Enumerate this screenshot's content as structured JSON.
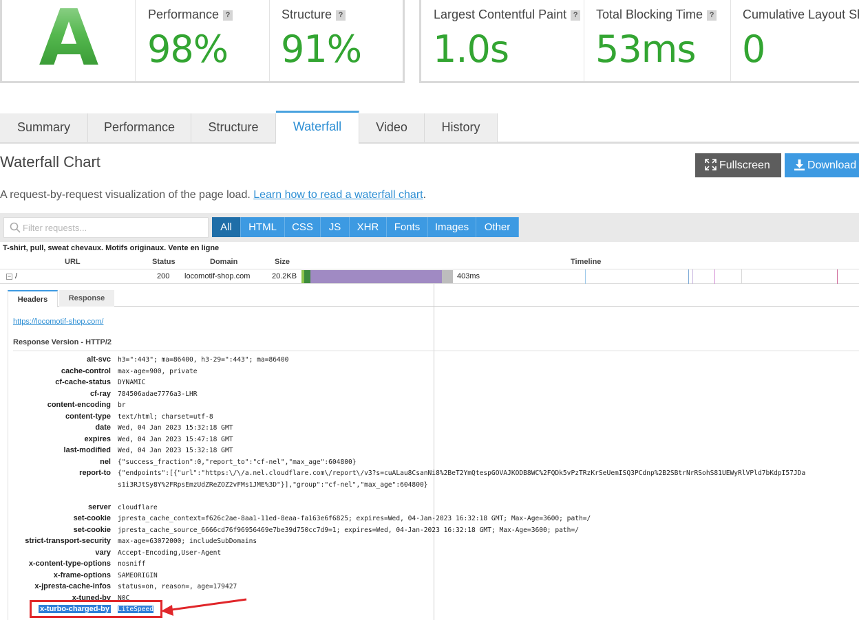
{
  "grade": {
    "letter": "A"
  },
  "metrics": [
    {
      "label": "Performance",
      "value": "98%",
      "help": "?"
    },
    {
      "label": "Structure",
      "value": "91%",
      "help": "?"
    }
  ],
  "vitals": [
    {
      "label": "Largest Contentful Paint",
      "value": "1.0s",
      "help": "?"
    },
    {
      "label": "Total Blocking Time",
      "value": "53ms",
      "help": "?"
    },
    {
      "label": "Cumulative Layout Shif",
      "value": "0"
    }
  ],
  "tabs": [
    "Summary",
    "Performance",
    "Structure",
    "Waterfall",
    "Video",
    "History"
  ],
  "active_tab": "Waterfall",
  "section": {
    "title": "Waterfall Chart",
    "fullscreen_label": "Fullscreen",
    "download_label": "Download",
    "description": "A request-by-request visualization of the page load.",
    "learn_link": "Learn how to read a waterfall chart",
    "period": "."
  },
  "filter": {
    "placeholder": "Filter requests...",
    "buttons": [
      "All",
      "HTML",
      "CSS",
      "JS",
      "XHR",
      "Fonts",
      "Images",
      "Other"
    ],
    "active": "All"
  },
  "waterfall": {
    "page_title": "T-shirt, pull, sweat chevaux. Motifs originaux. Vente en ligne",
    "columns": {
      "url": "URL",
      "status": "Status",
      "domain": "Domain",
      "size": "Size",
      "timeline": "Timeline"
    },
    "row": {
      "expand": "−",
      "url": "/",
      "status": "200",
      "domain": "locomotif-shop.com",
      "size": "20.2KB",
      "time": "403ms"
    },
    "colors": {
      "dns": "#8bc34a",
      "connect": "#3d8b3d",
      "wait": "#a08ac3",
      "receive": "#bdbdbd"
    }
  },
  "details": {
    "tabs": [
      "Headers",
      "Response"
    ],
    "url": "https://locomotif-shop.com/",
    "response_version": "Response Version - HTTP/2",
    "headers": [
      {
        "name": "alt-svc",
        "value": "h3=\":443\"; ma=86400, h3-29=\":443\"; ma=86400"
      },
      {
        "name": "cache-control",
        "value": "max-age=900, private"
      },
      {
        "name": "cf-cache-status",
        "value": "DYNAMIC"
      },
      {
        "name": "cf-ray",
        "value": "784506adae7776a3-LHR"
      },
      {
        "name": "content-encoding",
        "value": "br"
      },
      {
        "name": "content-type",
        "value": "text/html; charset=utf-8"
      },
      {
        "name": "date",
        "value": "Wed, 04 Jan 2023 15:32:18 GMT"
      },
      {
        "name": "expires",
        "value": "Wed, 04 Jan 2023 15:47:18 GMT"
      },
      {
        "name": "last-modified",
        "value": "Wed, 04 Jan 2023 15:32:18 GMT"
      },
      {
        "name": "nel",
        "value": "{\"success_fraction\":0,\"report_to\":\"cf-nel\",\"max_age\":604800}"
      },
      {
        "name": "report-to",
        "value": "{\"endpoints\":[{\"url\":\"https:\\/\\/a.nel.cloudflare.com\\/report\\/v3?s=cuALau8CsanNi8%2BeT2YmQtespGOVAJKODB8WC%2FQDk5vPzTRzKrSeUemISQ3PCdnp%2B2SBtrNrRSohS81UEWyRlVPld7bKdpI57JDas1i3RJtSy8Y%2FRpsEmzUdZReZOZ2vFMs1JME%3D\"}],\"group\":\"cf-nel\",\"max_age\":604800}"
      },
      {
        "name": "server",
        "value": "cloudflare"
      },
      {
        "name": "set-cookie",
        "value": "jpresta_cache_context=f626c2ae-8aa1-11ed-8eaa-fa163e6f6825; expires=Wed, 04-Jan-2023 16:32:18 GMT; Max-Age=3600; path=/"
      },
      {
        "name": "set-cookie",
        "value": "jpresta_cache_source_6666cd76f96956469e7be39d750cc7d9=1; expires=Wed, 04-Jan-2023 16:32:18 GMT; Max-Age=3600; path=/"
      },
      {
        "name": "strict-transport-security",
        "value": "max-age=63072000; includeSubDomains"
      },
      {
        "name": "vary",
        "value": "Accept-Encoding,User-Agent"
      },
      {
        "name": "x-content-type-options",
        "value": "nosniff"
      },
      {
        "name": "x-frame-options",
        "value": "SAMEORIGIN"
      },
      {
        "name": "x-jpresta-cache-infos",
        "value": "status=on, reason=, age=179427"
      },
      {
        "name": "x-tuned-by",
        "value": "N0C"
      },
      {
        "name": "x-turbo-charged-by",
        "value": "LiteSpeed",
        "highlighted": true
      }
    ]
  },
  "colors": {
    "accent": "#3d9ae2",
    "grade_green": "#33a532",
    "annotation": "#e0262a"
  }
}
